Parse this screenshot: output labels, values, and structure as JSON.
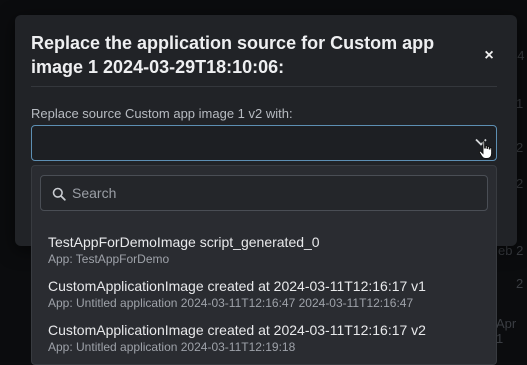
{
  "background": {
    "fragments": [
      "24",
      "r 1",
      "2",
      "2",
      "eb 2",
      "Apr 1",
      "2"
    ]
  },
  "modal": {
    "title_line1": "Replace the application source for Custom app",
    "title_line2": "image 1 2024-03-29T18:10:06:",
    "close_label": "×",
    "field_label": "Replace source Custom app image 1 v2 with:",
    "select_value": ""
  },
  "dropdown": {
    "search_placeholder": "Search",
    "options": [
      {
        "title": "TestAppForDemoImage script_generated_0",
        "subtitle": "App: TestAppForDemo"
      },
      {
        "title": "CustomApplicationImage created at 2024-03-11T12:16:17 v1",
        "subtitle": "App: Untitled application 2024-03-11T12:16:47 2024-03-11T12:16:47"
      },
      {
        "title": "CustomApplicationImage created at 2024-03-11T12:16:17 v2",
        "subtitle": "App: Untitled application 2024-03-11T12:19:18"
      }
    ]
  },
  "colors": {
    "modal_bg": "#212327",
    "focus_border": "#5d8fb3",
    "dropdown_bg": "#2a2c31"
  }
}
